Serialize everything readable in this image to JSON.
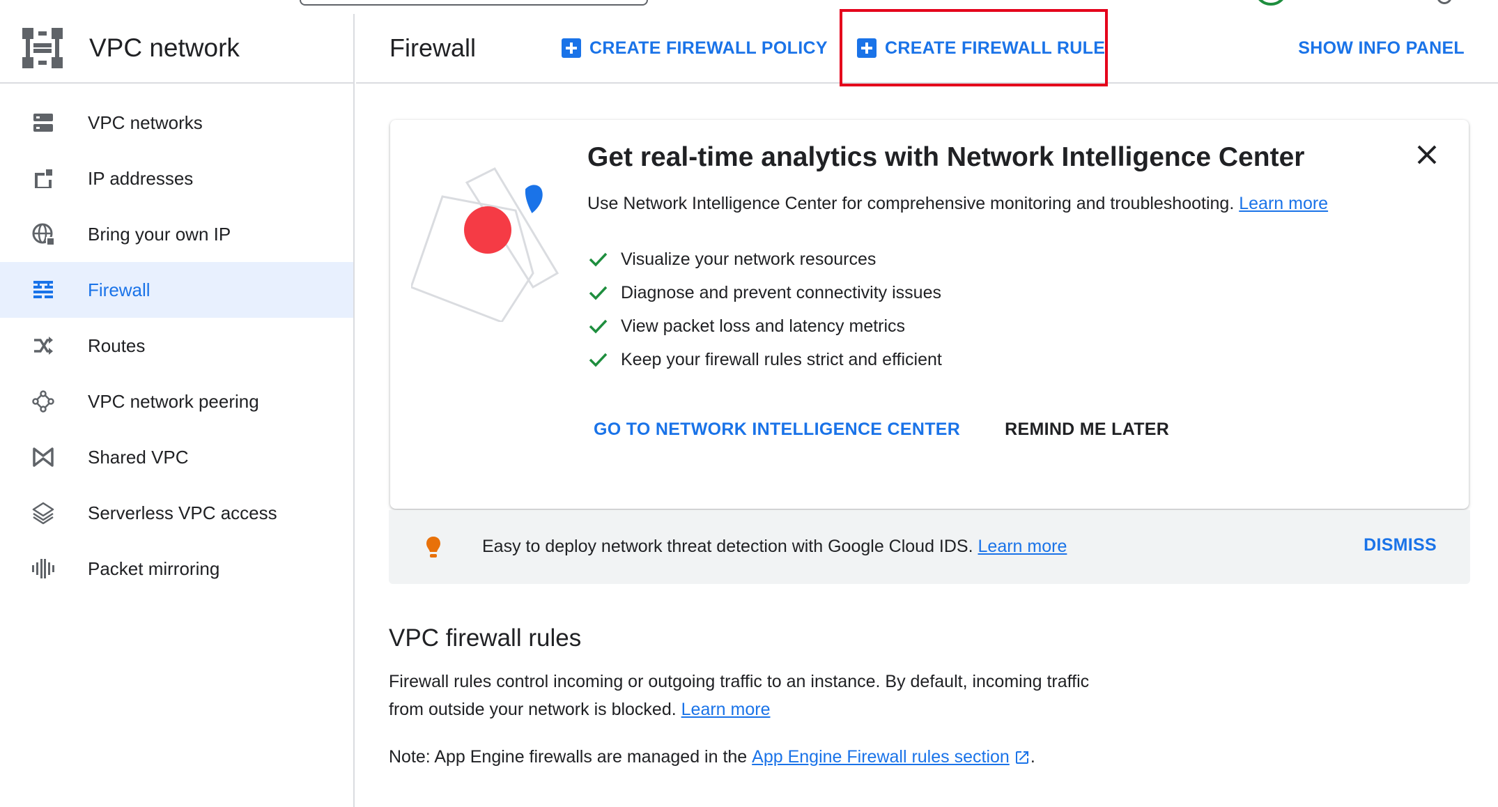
{
  "app": {
    "title": "VPC network"
  },
  "sidebar": {
    "items": [
      {
        "label": "VPC networks",
        "icon": "vpc-networks-icon"
      },
      {
        "label": "IP addresses",
        "icon": "ip-addresses-icon"
      },
      {
        "label": "Bring your own IP",
        "icon": "globe-icon"
      },
      {
        "label": "Firewall",
        "icon": "firewall-icon",
        "active": true
      },
      {
        "label": "Routes",
        "icon": "routes-icon"
      },
      {
        "label": "VPC network peering",
        "icon": "peering-icon"
      },
      {
        "label": "Shared VPC",
        "icon": "shared-vpc-icon"
      },
      {
        "label": "Serverless VPC access",
        "icon": "serverless-icon"
      },
      {
        "label": "Packet mirroring",
        "icon": "packet-mirroring-icon"
      }
    ]
  },
  "header": {
    "page_title": "Firewall",
    "create_policy_label": "CREATE FIREWALL POLICY",
    "create_rule_label": "CREATE FIREWALL RULE",
    "info_panel_label": "SHOW INFO PANEL"
  },
  "promo": {
    "title": "Get real-time analytics with Network Intelligence Center",
    "description": "Use Network Intelligence Center for comprehensive monitoring and troubleshooting.",
    "learn_more": "Learn more",
    "features": [
      "Visualize your network resources",
      "Diagnose and prevent connectivity issues",
      "View packet loss and latency metrics",
      "Keep your firewall rules strict and efficient"
    ],
    "primary_action": "GO TO NETWORK INTELLIGENCE CENTER",
    "secondary_action": "REMIND ME LATER"
  },
  "banner": {
    "text": "Easy to deploy network threat detection with Google Cloud IDS.",
    "learn_more": "Learn more",
    "dismiss": "DISMISS"
  },
  "section": {
    "title": "VPC firewall rules",
    "description": "Firewall rules control incoming or outgoing traffic to an instance. By default, incoming traffic from outside your network is blocked.",
    "learn_more": "Learn more",
    "note_prefix": "Note: App Engine firewalls are managed in the",
    "note_link": "App Engine Firewall rules section",
    "note_suffix": "."
  },
  "colors": {
    "accent": "#1a73e8",
    "active_bg": "#e8f0fe",
    "highlight": "#e4001b",
    "check": "#1e8e3e",
    "bulb": "#e8710a"
  }
}
